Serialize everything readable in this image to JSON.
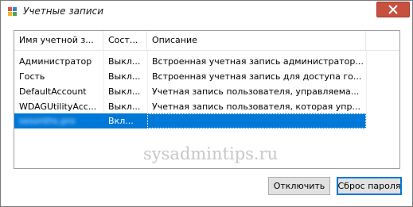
{
  "window": {
    "title": "Учетные записи",
    "app_icon": "users-app-icon",
    "close_icon": "close-icon",
    "close_color": "#c7503f"
  },
  "listview": {
    "columns": [
      "Имя учетной з...",
      "Сост...",
      "Описание"
    ],
    "rows": [
      {
        "name": "Администратор",
        "state": "Выкл...",
        "desc": "Встроенная учетная запись администратор..."
      },
      {
        "name": "Гость",
        "state": "Выкл...",
        "desc": "Встроенная учетная запись для доступа го..."
      },
      {
        "name": "DefaultAccount",
        "state": "Выкл...",
        "desc": "Учетная запись пользователя, управляема..."
      },
      {
        "name": "WDAGUtilityAcc...",
        "state": "Выкл...",
        "desc": "Учетная запись пользователя, которая упр..."
      },
      {
        "name": "sesonths.pro",
        "state": "Вкл...",
        "desc": ""
      }
    ],
    "selected_index": 4,
    "selection_color": "#0078d7"
  },
  "watermark": "sysadmintips.ru",
  "buttons": {
    "disable_label": "Отключить",
    "reset_label": "Сброс пароля"
  }
}
